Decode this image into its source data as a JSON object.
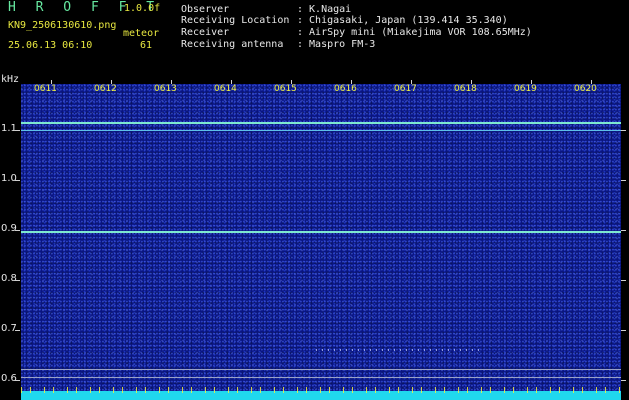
{
  "header": {
    "title": "H R O F F T",
    "version": "1.0.0f",
    "filename": "KN9_2506130610.png",
    "datetime": "25.06.13 06:10",
    "meteor_label": "meteor",
    "meteor_count": "61"
  },
  "info": [
    {
      "key": "Observer",
      "value": ": K.Nagai"
    },
    {
      "key": "Receiving Location",
      "value": ": Chigasaki, Japan (139.414 35.340)"
    },
    {
      "key": "Receiver",
      "value": ": AirSpy mini (Miakejima VOR 108.65MHz)"
    },
    {
      "key": "Receiving antenna",
      "value": ": Maspro FM-3"
    }
  ],
  "plot": {
    "y_unit": "kHz",
    "time_labels": [
      "0611",
      "0612",
      "0613",
      "0614",
      "0615",
      "0616",
      "0617",
      "0618",
      "0619",
      "0620"
    ],
    "y_labels": [
      "1.1",
      "1.0",
      "0.9",
      "0.8",
      "0.7",
      "0.6"
    ],
    "colors": {
      "background": "#0a1580",
      "carrier": "#7de8d0",
      "bottom_band": "#20d8ee",
      "meteor_ticks": "#f0f040"
    }
  }
}
